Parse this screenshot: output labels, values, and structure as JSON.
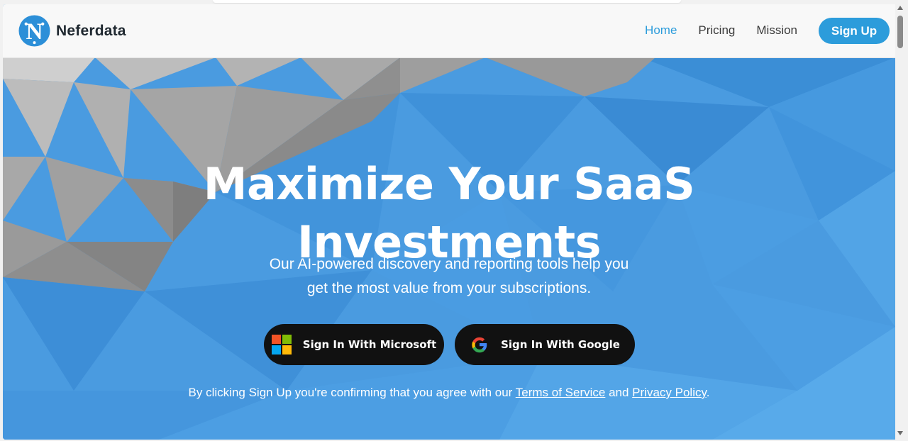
{
  "brand": {
    "name": "Neferdata",
    "logo_letter": "N",
    "logo_icon": "neferdata-logo-icon"
  },
  "nav": {
    "links": [
      {
        "label": "Home",
        "active": true
      },
      {
        "label": "Pricing",
        "active": false
      },
      {
        "label": "Mission",
        "active": false
      }
    ],
    "signup_label": "Sign Up"
  },
  "hero": {
    "title_line1": "Maximize Your SaaS",
    "title_line2": "Investments",
    "subtitle_line1": "Our AI-powered discovery and reporting tools help you",
    "subtitle_line2": "get the most value from your subscriptions.",
    "microsoft_label": "Sign In With Microsoft",
    "microsoft_icon": "microsoft-logo-icon",
    "google_label": "Sign In With Google",
    "google_icon": "google-logo-icon",
    "consent_prefix": "By clicking Sign Up you're confirming that you agree with our ",
    "terms_label": "Terms of Service",
    "consent_and": " and ",
    "privacy_label": "Privacy Policy",
    "consent_suffix": "."
  },
  "colors": {
    "accent": "#2c9cdb",
    "hero_blue": "#4a9be0",
    "button_dark": "#111111",
    "text_dark": "#1f2830"
  }
}
